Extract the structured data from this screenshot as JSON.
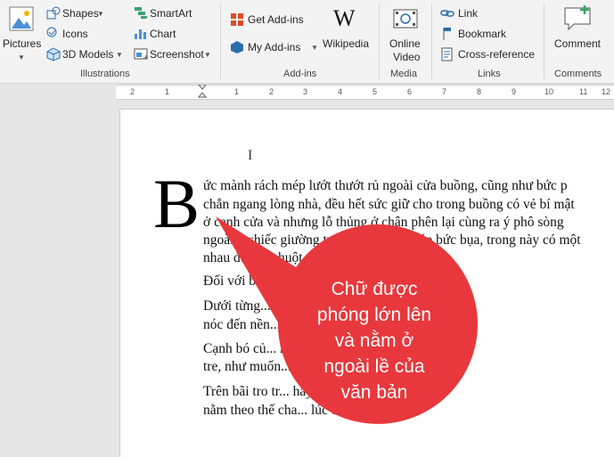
{
  "ribbon": {
    "illustrations": {
      "pictures": "Pictures",
      "shapes": "Shapes",
      "icons": "Icons",
      "models": "3D Models",
      "smartart": "SmartArt",
      "chart": "Chart",
      "screenshot": "Screenshot",
      "group_label": "Illustrations"
    },
    "addins": {
      "get_addins": "Get Add-ins",
      "my_addins": "My Add-ins",
      "wikipedia": "Wikipedia",
      "group_label": "Add-ins"
    },
    "media": {
      "online_video_1": "Online",
      "online_video_2": "Video",
      "group_label": "Media"
    },
    "links": {
      "link": "Link",
      "bookmark": "Bookmark",
      "cross_reference": "Cross-reference",
      "group_label": "Links"
    },
    "comments": {
      "comment": "Comment",
      "group_label": "Comments"
    }
  },
  "ruler": {
    "marks": [
      "2",
      "1",
      "1",
      "2",
      "3",
      "4",
      "5",
      "6",
      "7",
      "8",
      "9",
      "10",
      "11",
      "12"
    ]
  },
  "document": {
    "drop_cap": "B",
    "lines": [
      "ức mành rách mép lướt thướt rủ ngoài cửa buồng, cũng như bức p",
      "chắn ngang lòng nhà, đều hết sức giữ cho trong buồng có vẻ bí mật",
      "ở cạnh cửa và nhưng lỗ thủng ở chân phên lại cùng ra ý phô sòng",
      "ngoài... chiếc giường tre gẫy giát, kê giáp bức bụa, trong này có một",
      "nhau đuổi... chuột.",
      "Đối với bu... lại càng bề bộn.",
      "Dưới từng... ánh sáng xanh tía, tho",
      "nóc đến nền... qua mưa dột.",
      "Cạnh bó củ... nghiêng hềnh hệch nằm n",
      "tre, như muốn..., lông lốc lăn nghiêng l",
      "Trên bãi tro tr... hay hòn gạch vỡ chẩu đầu v",
      "nằm theo thế cha... lúc đội nổi."
    ],
    "cursor": "I"
  },
  "callout": {
    "text_lines": [
      "Chữ được",
      "phóng lớn lên",
      "và nằm ở",
      "ngoài lề của",
      "văn bản"
    ],
    "color": "#e8383d"
  }
}
